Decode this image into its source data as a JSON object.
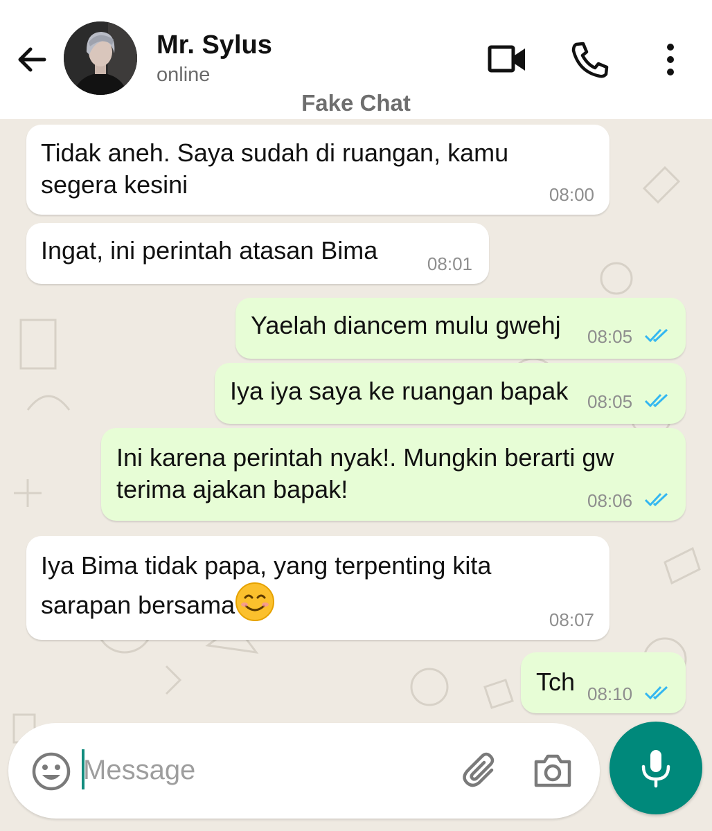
{
  "header": {
    "contact_name": "Mr. Sylus",
    "status": "online",
    "subtitle": "Fake Chat",
    "icons": [
      "back-arrow-icon",
      "video-call-icon",
      "phone-icon",
      "more-vert-icon"
    ]
  },
  "messages": [
    {
      "direction": "in",
      "text": "Tidak aneh. Saya sudah di ruangan, kamu\nsegera kesini",
      "time": "08:00"
    },
    {
      "direction": "in",
      "text": "Ingat, ini perintah atasan Bima",
      "time": "08:01"
    },
    {
      "direction": "out",
      "text": "Yaelah diancem mulu gwehj",
      "time": "08:05",
      "status": "read"
    },
    {
      "direction": "out",
      "text": "Iya iya saya ke ruangan bapak",
      "time": "08:05",
      "status": "read"
    },
    {
      "direction": "out",
      "text": "Ini karena perintah nyak!. Mungkin berarti gw\nterima ajakan bapak!",
      "time": "08:06",
      "status": "read"
    },
    {
      "direction": "in",
      "text": "Iya Bima tidak papa, yang terpenting kita\nsarapan bersama",
      "emoji": "smiling-face-emoji",
      "time": "08:07"
    },
    {
      "direction": "out",
      "text": "Tch",
      "time": "08:10",
      "status": "read"
    }
  ],
  "composer": {
    "placeholder": "Message",
    "value": "",
    "icons": [
      "emoji-icon",
      "attach-icon",
      "camera-icon",
      "mic-icon"
    ]
  },
  "colors": {
    "incoming_bubble": "#ffffff",
    "outgoing_bubble": "#e7fdd6",
    "chat_background": "#efeae2",
    "read_ticks": "#34b7f1",
    "mic_button": "#00897b"
  }
}
